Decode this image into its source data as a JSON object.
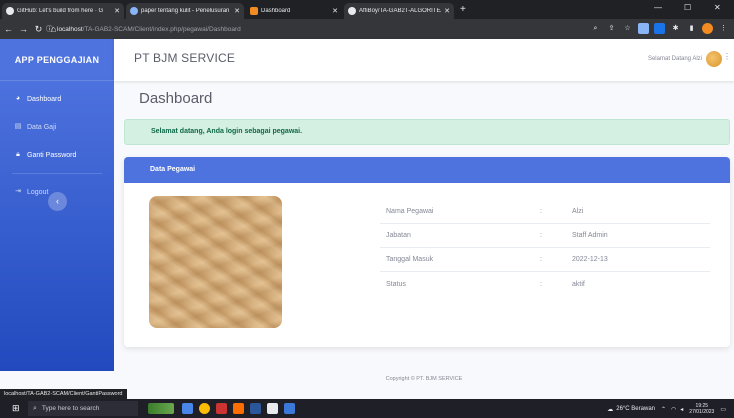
{
  "browser": {
    "tabs": [
      {
        "label": "GitHub: Let's build from here · G",
        "favicon": "github-icon"
      },
      {
        "label": "paper tentang kulit - Penelusuran",
        "favicon": "chrome-icon"
      },
      {
        "label": "Dashboard",
        "favicon": "dashboard-favicon"
      },
      {
        "label": "AffiBoy/TA-GAB2T-ALGORITEAI",
        "favicon": "github-icon"
      }
    ],
    "url_host": "localhost",
    "url_path": "/TA-GAB2-SCAM/Client/index.php/pegawai/Dashboard",
    "new_tab": "+",
    "window_controls": {
      "minimize": "—",
      "maximize": "☐",
      "close": "✕"
    }
  },
  "sidebar": {
    "brand": "APP PENGGAJIAN",
    "items": [
      {
        "label": "Dashboard",
        "icon": "palette-icon"
      },
      {
        "label": "Data Gaji",
        "icon": "table-icon"
      },
      {
        "label": "Ganti Password",
        "icon": "lock-icon"
      },
      {
        "label": "Logout",
        "icon": "logout-icon"
      }
    ],
    "toggle_icon": "‹"
  },
  "topbar": {
    "company": "PT BJM SERVICE",
    "welcome": "Selamat Datang Alzi"
  },
  "main": {
    "title": "Dashboard",
    "alert": "Selamat datang, Anda login sebagai pegawai.",
    "card_title": "Data Pegawai",
    "rows": [
      {
        "label": "Nama Pegawai",
        "sep": ":",
        "value": "Alzi"
      },
      {
        "label": "Jabatan",
        "sep": ":",
        "value": "Staff Admin"
      },
      {
        "label": "Tanggal Masuk",
        "sep": ":",
        "value": "2022-12-13"
      },
      {
        "label": "Status",
        "sep": ":",
        "value": "aktif"
      }
    ]
  },
  "footer": "Copyright © PT. BJM SERVICE",
  "status_url": "localhost/TA-GAB2-SCAM/Client/GantiPassword",
  "taskbar": {
    "search_placeholder": "Type here to search",
    "weather": "26°C Berawan",
    "time": "19:25",
    "date": "27/01/2023"
  },
  "colors": {
    "primary": "#4e73df",
    "primary_dark": "#224abe",
    "success_bg": "#d4f0e3",
    "success_text": "#0f6848"
  }
}
